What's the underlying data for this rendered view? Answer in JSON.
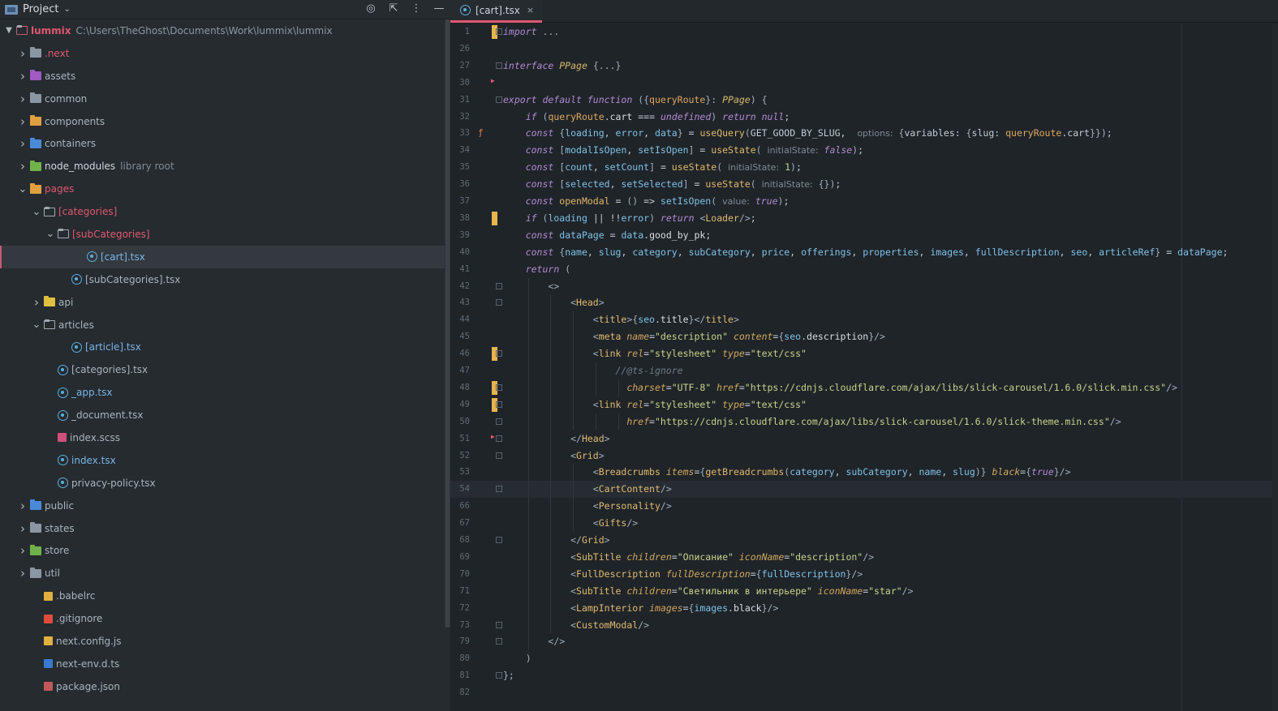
{
  "project_panel": {
    "title": "Project",
    "root": {
      "name": "lummix",
      "path": "C:\\Users\\TheGhost\\Documents\\Work\\lummix\\lummix"
    },
    "items": [
      {
        "label": ".next",
        "type": "folder",
        "depth": 1,
        "arrow": "right",
        "color": "red"
      },
      {
        "label": "assets",
        "type": "folder",
        "depth": 1,
        "arrow": "right",
        "color": "normal"
      },
      {
        "label": "common",
        "type": "folder",
        "depth": 1,
        "arrow": "right",
        "color": "normal"
      },
      {
        "label": "components",
        "type": "folder",
        "depth": 1,
        "arrow": "right",
        "color": "normal"
      },
      {
        "label": "containers",
        "type": "folder",
        "depth": 1,
        "arrow": "right",
        "color": "normal"
      },
      {
        "label": "node_modules",
        "hint": "library root",
        "type": "folder",
        "depth": 1,
        "arrow": "right",
        "color": "bright"
      },
      {
        "label": "pages",
        "type": "folder",
        "depth": 1,
        "arrow": "down",
        "color": "red"
      },
      {
        "label": "[categories]",
        "type": "folder",
        "depth": 2,
        "arrow": "down",
        "color": "red"
      },
      {
        "label": "[subCategories]",
        "type": "folder",
        "depth": 3,
        "arrow": "down",
        "color": "red"
      },
      {
        "label": "[cart].tsx",
        "type": "react",
        "depth": 5,
        "arrow": "",
        "color": "blue",
        "selected": true
      },
      {
        "label": "[subCategories].tsx",
        "type": "react",
        "depth": 4,
        "arrow": "",
        "color": "normal"
      },
      {
        "label": "api",
        "type": "folder",
        "depth": 2,
        "arrow": "right",
        "color": "normal"
      },
      {
        "label": "articles",
        "type": "folder",
        "depth": 2,
        "arrow": "down",
        "color": "normal"
      },
      {
        "label": "[article].tsx",
        "type": "react",
        "depth": 4,
        "arrow": "",
        "color": "blue"
      },
      {
        "label": "[categories].tsx",
        "type": "react",
        "depth": 3,
        "arrow": "",
        "color": "normal"
      },
      {
        "label": "_app.tsx",
        "type": "react",
        "depth": 3,
        "arrow": "",
        "color": "blue"
      },
      {
        "label": "_document.tsx",
        "type": "react",
        "depth": 3,
        "arrow": "",
        "color": "normal"
      },
      {
        "label": "index.scss",
        "type": "scss",
        "depth": 3,
        "arrow": "",
        "color": "normal"
      },
      {
        "label": "index.tsx",
        "type": "react",
        "depth": 3,
        "arrow": "",
        "color": "blue"
      },
      {
        "label": "privacy-policy.tsx",
        "type": "react",
        "depth": 3,
        "arrow": "",
        "color": "normal"
      },
      {
        "label": "public",
        "type": "folder",
        "depth": 1,
        "arrow": "right",
        "color": "normal"
      },
      {
        "label": "states",
        "type": "folder",
        "depth": 1,
        "arrow": "right",
        "color": "normal"
      },
      {
        "label": "store",
        "type": "folder",
        "depth": 1,
        "arrow": "right",
        "color": "normal"
      },
      {
        "label": "util",
        "type": "folder",
        "depth": 1,
        "arrow": "right",
        "color": "normal"
      },
      {
        "label": ".babelrc",
        "type": "babel",
        "depth": 2,
        "arrow": "",
        "color": "normal"
      },
      {
        "label": ".gitignore",
        "type": "git",
        "depth": 2,
        "arrow": "",
        "color": "normal"
      },
      {
        "label": "next.config.js",
        "type": "js",
        "depth": 2,
        "arrow": "",
        "color": "normal"
      },
      {
        "label": "next-env.d.ts",
        "type": "ts",
        "depth": 2,
        "arrow": "",
        "color": "normal"
      },
      {
        "label": "package.json",
        "type": "json",
        "depth": 2,
        "arrow": "",
        "color": "normal"
      }
    ]
  },
  "editor": {
    "tab": {
      "label": "[cart].tsx",
      "close": "×"
    },
    "lines": [
      {
        "n": "1",
        "html": "<span class=\"kw\">import</span> <span class=\"punc\">...</span>",
        "mark": true,
        "fold": true
      },
      {
        "n": "26",
        "html": ""
      },
      {
        "n": "27",
        "html": "<span class=\"kw\">interface</span> <span class=\"type\">PPage</span> <span class=\"punc\">{...}</span>",
        "fold": true
      },
      {
        "n": "30",
        "html": "",
        "warn": true
      },
      {
        "n": "31",
        "html": "<span class=\"kw\">export default function</span> <span class=\"punc\">({</span><span class=\"param\">queryRoute</span><span class=\"punc\">}:</span> <span class=\"type\">PPage</span><span class=\"punc\">) {</span>",
        "fold": true
      },
      {
        "n": "32",
        "html": "    <span class=\"kw\">if</span> <span class=\"punc\">(</span><span class=\"param\">queryRoute</span>.<span class=\"var\">cart</span> === <span class=\"kw\">undefined</span><span class=\"punc\">)</span> <span class=\"kw\">return null</span>;"
      },
      {
        "n": "33",
        "html": "    <span class=\"kw\">const</span> <span class=\"punc\">{</span><span class=\"blu\">loading</span>, <span class=\"blu\">error</span>, <span class=\"blu\">data</span><span class=\"punc\">}</span> = <span class=\"fn\">useQuery</span><span class=\"punc\">(</span>GET_GOOD_BY_SLUG,  <span class=\"inlay\">options:</span> <span class=\"punc\">{</span>variables: <span class=\"punc\">{</span>slug: <span class=\"param\">queryRoute</span>.cart<span class=\"punc\">}})</span>;",
        "hintIcon": true
      },
      {
        "n": "34",
        "html": "    <span class=\"kw\">const</span> <span class=\"punc\">[</span><span class=\"blu\">modalIsOpen</span>, <span class=\"blu\">setIsOpen</span><span class=\"punc\">]</span> = <span class=\"fn\">useState</span><span class=\"punc\">(</span> <span class=\"inlay\">initialState:</span> <span class=\"kw\">false</span><span class=\"punc\">)</span>;"
      },
      {
        "n": "35",
        "html": "    <span class=\"kw\">const</span> <span class=\"punc\">[</span><span class=\"blu\">count</span>, <span class=\"blu\">setCount</span><span class=\"punc\">]</span> = <span class=\"fn\">useState</span><span class=\"punc\">(</span> <span class=\"inlay\">initialState:</span> <span class=\"str\">1</span><span class=\"punc\">)</span>;"
      },
      {
        "n": "36",
        "html": "    <span class=\"kw\">const</span> <span class=\"punc\">[</span><span class=\"blu\">selected</span>, <span class=\"blu\">setSelected</span><span class=\"punc\">]</span> = <span class=\"fn\">useState</span><span class=\"punc\">(</span> <span class=\"inlay\">initialState:</span> <span class=\"punc\">{})</span>;"
      },
      {
        "n": "37",
        "html": "    <span class=\"kw\">const</span> <span class=\"fn\">openModal</span> = <span class=\"punc\">()</span> => <span class=\"blu\">setIsOpen</span><span class=\"punc\">(</span> <span class=\"inlay\">value:</span> <span class=\"kw\">true</span><span class=\"punc\">)</span>;"
      },
      {
        "n": "38",
        "html": "    <span class=\"kw\">if</span> <span class=\"punc\">(</span><span class=\"blu\">loading</span> || !!<span class=\"blu\">error</span><span class=\"punc\">)</span> <span class=\"kw\">return</span> <span class=\"punc\">&lt;</span><span class=\"tag\">Loader</span><span class=\"punc\">/&gt;</span>;",
        "mark": true
      },
      {
        "n": "39",
        "html": "    <span class=\"kw\">const</span> <span class=\"blu\">dataPage</span> = <span class=\"blu\">data</span>.<span class=\"var\">good_by_pk</span>;"
      },
      {
        "n": "40",
        "html": "    <span class=\"kw\">const</span> <span class=\"punc\">{</span><span class=\"blu\">name</span>, <span class=\"blu\">slug</span>, <span class=\"blu\">category</span>, <span class=\"blu\">subCategory</span>, <span class=\"blu\">price</span>, <span class=\"blu\">offerings</span>, <span class=\"blu\">properties</span>, <span class=\"blu\">images</span>, <span class=\"blu\">fullDescription</span>, <span class=\"blu\">seo</span>, <span class=\"blu\">articleRef</span><span class=\"punc\">}</span> = <span class=\"blu\">dataPage</span>;"
      },
      {
        "n": "41",
        "html": "    <span class=\"kw\">return</span> <span class=\"punc\">(</span>"
      },
      {
        "n": "42",
        "html": "        <span class=\"punc\">&lt;&gt;</span>",
        "fold": true
      },
      {
        "n": "43",
        "html": "            <span class=\"punc\">&lt;</span><span class=\"tag\">Head</span><span class=\"punc\">&gt;</span>",
        "fold": true
      },
      {
        "n": "44",
        "html": "                <span class=\"punc\">&lt;</span><span class=\"tag\">title</span><span class=\"punc\">&gt;{</span><span class=\"blu\">seo</span>.<span class=\"var\">title</span><span class=\"punc\">}&lt;/</span><span class=\"tag\">title</span><span class=\"punc\">&gt;</span>"
      },
      {
        "n": "45",
        "html": "                <span class=\"punc\">&lt;</span><span class=\"tag\">meta</span> <span class=\"attr\">name</span>=<span class=\"str\">\"description\"</span> <span class=\"attr\">content</span>=<span class=\"punc\">{</span><span class=\"blu\">seo</span>.<span class=\"var\">description</span><span class=\"punc\">}/&gt;</span>"
      },
      {
        "n": "46",
        "html": "                <span class=\"punc\">&lt;</span><span class=\"tag\">link</span> <span class=\"attr\">rel</span>=<span class=\"str\">\"stylesheet\"</span> <span class=\"attr\">type</span>=<span class=\"str\">\"text/css\"</span>",
        "mark": true,
        "fold": true
      },
      {
        "n": "47",
        "html": "                    <span class=\"cmt\">//@ts-ignore</span>"
      },
      {
        "n": "48",
        "html": "                      <span class=\"attr\">charset</span>=<span class=\"str\">\"UTF-8\"</span> <span class=\"attr\">href</span>=<span class=\"str\">\"https://cdnjs.cloudflare.com/ajax/libs/slick-carousel/1.6.0/slick.min.css\"</span><span class=\"punc\">/&gt;</span>",
        "mark": true,
        "fold": true
      },
      {
        "n": "49",
        "html": "                <span class=\"punc\">&lt;</span><span class=\"tag\">link</span> <span class=\"attr\">rel</span>=<span class=\"str\">\"stylesheet\"</span> <span class=\"attr\">type</span>=<span class=\"str\">\"text/css\"</span>",
        "mark": true,
        "fold": true
      },
      {
        "n": "50",
        "html": "                      <span class=\"attr\">href</span>=<span class=\"str\">\"https://cdnjs.cloudflare.com/ajax/libs/slick-carousel/1.6.0/slick-theme.min.css\"</span><span class=\"punc\">/&gt;</span>",
        "fold": true
      },
      {
        "n": "51",
        "html": "            <span class=\"punc\">&lt;/</span><span class=\"tag\">Head</span><span class=\"punc\">&gt;</span>",
        "fold": true,
        "warn": true
      },
      {
        "n": "52",
        "html": "            <span class=\"punc\">&lt;</span><span class=\"tag\">Grid</span><span class=\"punc\">&gt;</span>",
        "fold": true
      },
      {
        "n": "53",
        "html": "                <span class=\"punc\">&lt;</span><span class=\"tag\">Breadcrumbs</span> <span class=\"attr\">items</span>=<span class=\"punc\">{</span><span class=\"fn\">getBreadcrumbs</span><span class=\"punc\">(</span><span class=\"blu\">category</span>, <span class=\"blu\">subCategory</span>, <span class=\"blu\">name</span>, <span class=\"blu\">slug</span><span class=\"punc\">)}</span> <span class=\"attr\">black</span>=<span class=\"punc\">{</span><span class=\"kw\">true</span><span class=\"punc\">}/&gt;</span>"
      },
      {
        "n": "54",
        "html": "                <span class=\"punc\">&lt;</span><span class=\"tag\">CartContent</span><span class=\"punc\">/&gt;</span>",
        "fold": true,
        "current": true
      },
      {
        "n": "66",
        "html": "                <span class=\"punc\">&lt;</span><span class=\"tag\">Personality</span><span class=\"punc\">/&gt;</span>"
      },
      {
        "n": "67",
        "html": "                <span class=\"punc\">&lt;</span><span class=\"tag\">Gifts</span><span class=\"punc\">/&gt;</span>"
      },
      {
        "n": "68",
        "html": "            <span class=\"punc\">&lt;/</span><span class=\"tag\">Grid</span><span class=\"punc\">&gt;</span>",
        "fold": true
      },
      {
        "n": "69",
        "html": "            <span class=\"punc\">&lt;</span><span class=\"tag\">SubTitle</span> <span class=\"attr\">children</span>=<span class=\"str\">\"Описание\"</span> <span class=\"attr\">iconName</span>=<span class=\"str\">\"description\"</span><span class=\"punc\">/&gt;</span>"
      },
      {
        "n": "70",
        "html": "            <span class=\"punc\">&lt;</span><span class=\"tag\">FullDescription</span> <span class=\"attr\">fullDescription</span>=<span class=\"punc\">{</span><span class=\"blu\">fullDescription</span><span class=\"punc\">}/&gt;</span>"
      },
      {
        "n": "71",
        "html": "            <span class=\"punc\">&lt;</span><span class=\"tag\">SubTitle</span> <span class=\"attr\">children</span>=<span class=\"str\">\"Светильник в интерьере\"</span> <span class=\"attr\">iconName</span>=<span class=\"str\">\"star\"</span><span class=\"punc\">/&gt;</span>"
      },
      {
        "n": "72",
        "html": "            <span class=\"punc\">&lt;</span><span class=\"tag\">LampInterior</span> <span class=\"attr\">images</span>=<span class=\"punc\">{</span><span class=\"blu\">images</span>.<span class=\"var\">black</span><span class=\"punc\">}/&gt;</span>"
      },
      {
        "n": "73",
        "html": "            <span class=\"punc\">&lt;</span><span class=\"tag\">CustomModal</span><span class=\"punc\">/&gt;</span>",
        "fold": true
      },
      {
        "n": "79",
        "html": "        <span class=\"punc\">&lt;/&gt;</span>",
        "fold": true
      },
      {
        "n": "80",
        "html": "    <span class=\"punc\">)</span>"
      },
      {
        "n": "81",
        "html": "<span class=\"punc\">};</span>",
        "fold": true
      },
      {
        "n": "82",
        "html": ""
      }
    ]
  },
  "colors": {
    "accent": "#e0586f",
    "change_marker": "#e8b44f",
    "selected_row": "#34393f"
  }
}
